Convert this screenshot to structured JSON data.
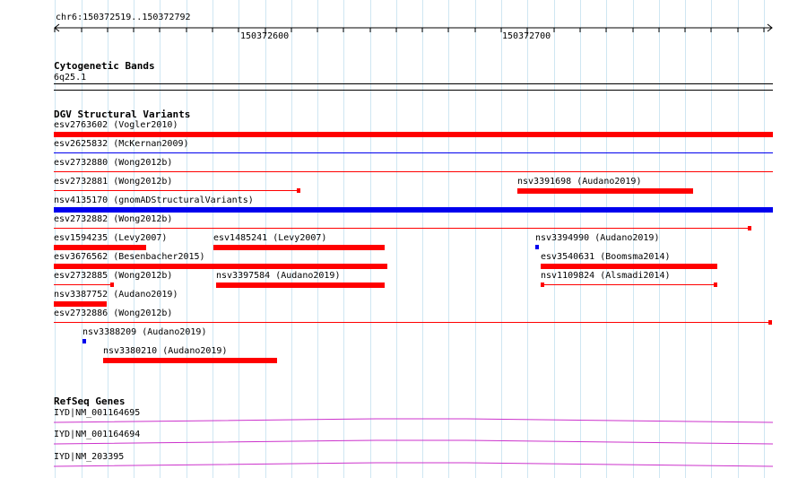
{
  "ruler": {
    "location": "chr6:150372519..150372792",
    "tick1": "150372600",
    "tick2": "150372700"
  },
  "cytoband": {
    "title": "Cytogenetic Bands",
    "band": "6q25.1"
  },
  "dgv": {
    "title": "DGV Structural Variants",
    "features": [
      {
        "label": "esv2763602 (Vogler2010)"
      },
      {
        "label": "esv2625832 (McKernan2009)"
      },
      {
        "label": "esv2732880 (Wong2012b)"
      },
      {
        "label": "esv2732881 (Wong2012b)"
      },
      {
        "label": "nsv3391698 (Audano2019)"
      },
      {
        "label": "nsv4135170 (gnomADStructuralVariants)"
      },
      {
        "label": "esv2732882 (Wong2012b)"
      },
      {
        "label": "esv1594235 (Levy2007)"
      },
      {
        "label": "esv1485241 (Levy2007)"
      },
      {
        "label": "nsv3394990 (Audano2019)"
      },
      {
        "label": "esv3676562 (Besenbacher2015)"
      },
      {
        "label": "esv3540631 (Boomsma2014)"
      },
      {
        "label": "esv2732885 (Wong2012b)"
      },
      {
        "label": "nsv3397584 (Audano2019)"
      },
      {
        "label": "nsv1109824 (Alsmadi2014)"
      },
      {
        "label": "nsv3387752 (Audano2019)"
      },
      {
        "label": "esv2732886 (Wong2012b)"
      },
      {
        "label": "nsv3388209 (Audano2019)"
      },
      {
        "label": "nsv3380210 (Audano2019)"
      }
    ]
  },
  "refseq": {
    "title": "RefSeq Genes",
    "genes": [
      {
        "label": "IYD|NM_001164695"
      },
      {
        "label": "IYD|NM_001164694"
      },
      {
        "label": "IYD|NM_203395"
      }
    ]
  },
  "colors": {
    "loss": "#ff0000",
    "gain": "#0000ee",
    "gene": "#cc33cc",
    "grid": "#cfe6f2"
  }
}
